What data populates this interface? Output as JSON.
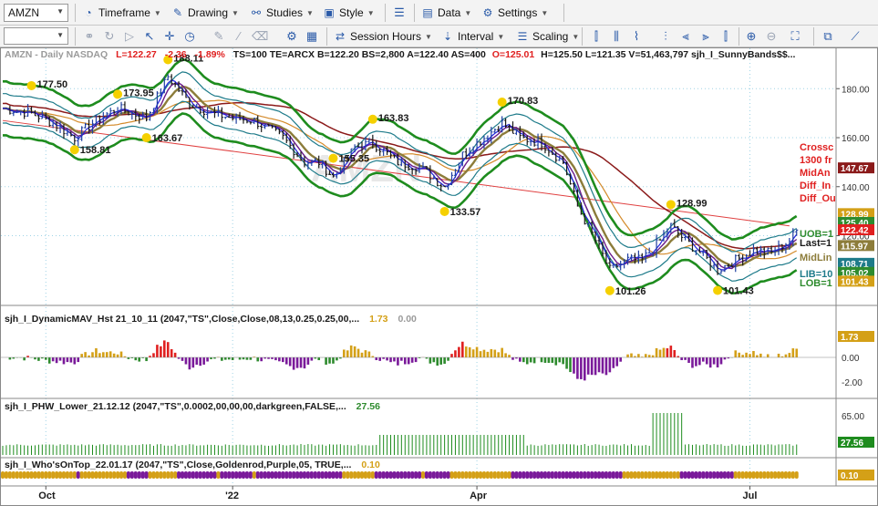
{
  "toolbar": {
    "symbol": "AMZN",
    "timeframe": "Timeframe",
    "drawing": "Drawing",
    "studies": "Studies",
    "style": "Style",
    "data": "Data",
    "settings": "Settings",
    "session_hours": "Session Hours",
    "interval": "Interval",
    "scaling": "Scaling"
  },
  "header": {
    "symbol_line": "AMZN - Daily  NASDAQ",
    "last": "L=122.27",
    "change": "-2.36",
    "change_pct": "-1.89%",
    "params": "TS=100  TE=ARCX  B=122.20  BS=2,800  A=122.40  AS=400",
    "open": "O=125.01",
    "rest": "H=125.50  L=121.35  V=51,463,797  sjh_I_SunnyBands$$..."
  },
  "price_labels": [
    {
      "text": "177.50",
      "price": 177.5,
      "day": 8
    },
    {
      "text": "188.11",
      "price": 188.1,
      "day": 46
    },
    {
      "text": "173.95",
      "price": 174.0,
      "day": 32
    },
    {
      "text": "163.67",
      "price": 163.7,
      "day": 40
    },
    {
      "text": "158.81",
      "price": 158.8,
      "day": 20
    },
    {
      "text": "163.83",
      "price": 163.8,
      "day": 103
    },
    {
      "text": "155.35",
      "price": 155.3,
      "day": 92
    },
    {
      "text": "133.57",
      "price": 133.6,
      "day": 123
    },
    {
      "text": "170.83",
      "price": 170.8,
      "day": 139
    },
    {
      "text": "128.99",
      "price": 129.0,
      "day": 186
    },
    {
      "text": "101.26",
      "price": 101.3,
      "day": 169
    },
    {
      "text": "101.43",
      "price": 101.4,
      "day": 199
    }
  ],
  "price_axis": {
    "ticks": [
      "180.00",
      "160.00",
      "140.00",
      "120.00"
    ],
    "tags": [
      {
        "text": "147.67",
        "color": "#8b1a1a",
        "price": 147.67
      },
      {
        "text": "128.99",
        "color": "#d4a017",
        "price": 128.99
      },
      {
        "text": "125.40",
        "color": "#2e8b2e",
        "price": 125.4
      },
      {
        "text": "122.42",
        "color": "#e02020",
        "price": 122.42
      },
      {
        "text": "115.97",
        "color": "#8c7c3a",
        "price": 115.97
      },
      {
        "text": "108.71",
        "color": "#1e7b8a",
        "price": 108.71
      },
      {
        "text": "105.02",
        "color": "#2e8b2e",
        "price": 105.02
      },
      {
        "text": "101.43",
        "color": "#d4a017",
        "price": 101.43
      }
    ]
  },
  "right_labels": [
    {
      "text": "Crossc",
      "color": "#e02020"
    },
    {
      "text": "1300 fr",
      "color": "#e02020"
    },
    {
      "text": "MidAn",
      "color": "#e02020"
    },
    {
      "text": "Diff_In",
      "color": "#e02020"
    },
    {
      "text": "Diff_Ou",
      "color": "#e02020"
    },
    {
      "text": "UOB=1",
      "color": "#2e8b2e"
    },
    {
      "text": "Last=1",
      "color": "#1a1a1a"
    },
    {
      "text": "MidLin",
      "color": "#8c7c3a"
    },
    {
      "text": "LIB=10",
      "color": "#1e7b8a"
    },
    {
      "text": "LOB=1",
      "color": "#2e8b2e"
    }
  ],
  "subpanes": [
    {
      "title": "sjh_I_DynamicMAV_Hst 21_10_11 (2047,\"TS\",Close,Close,08,13,0.25,0.25,00,...",
      "value1": "1.73",
      "value2": "0.00",
      "ticks": [
        "1.73",
        "0.00",
        "-2.00"
      ]
    },
    {
      "title": "sjh_I_PHW_Lower_21.12.12 (2047,\"TS\",0.0002,00,00,00,darkgreen,FALSE,...",
      "value1": "27.56",
      "ticks": [
        "65.00",
        "27.56"
      ]
    },
    {
      "title": "sjh_I_Who'sOnTop_22.01.17 (2047,\"TS\",Close,Goldenrod,Purple,05, TRUE,...",
      "value1": "0.10",
      "ticks": [
        "0.10"
      ]
    }
  ],
  "date_axis": [
    {
      "label": "Oct",
      "day": 12
    },
    {
      "label": "'22",
      "day": 64
    },
    {
      "label": "Apr",
      "day": 132
    },
    {
      "label": "Jul",
      "day": 208
    }
  ],
  "watermark": "AMZN",
  "colors": {
    "up_bar": "#1f3fa0",
    "down_bar": "#1a1a1a",
    "outer_band": "#1e8c1e",
    "inner_band": "#1e7b8a",
    "mid": "#6a1a8a",
    "slow_ma": "#8b1a1a",
    "trend": "#e04040",
    "gold": "#d4a017",
    "purple": "#7a1a9a",
    "red": "#e02020",
    "green": "#2e8b2e"
  }
}
